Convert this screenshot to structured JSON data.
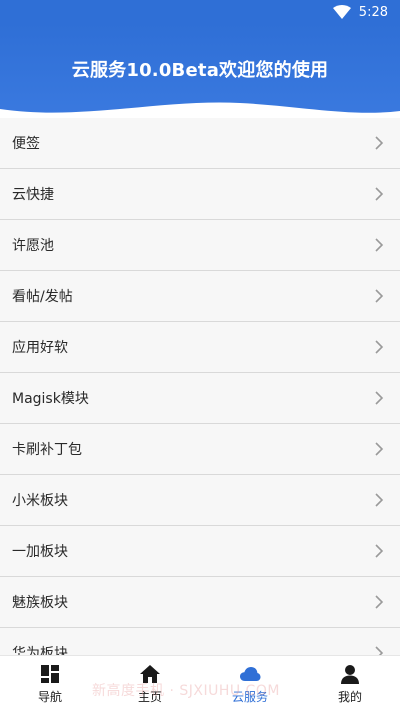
{
  "status_bar": {
    "time": "5:28"
  },
  "header": {
    "title": "云服务10.0Beta欢迎您的使用"
  },
  "list": {
    "items": [
      {
        "label": "便签"
      },
      {
        "label": "云快捷"
      },
      {
        "label": "许愿池"
      },
      {
        "label": "看帖/发帖"
      },
      {
        "label": "应用好软"
      },
      {
        "label": "Magisk模块"
      },
      {
        "label": "卡刷补丁包"
      },
      {
        "label": "小米板块"
      },
      {
        "label": "一加板块"
      },
      {
        "label": "魅族板块"
      },
      {
        "label": "华为板块"
      }
    ]
  },
  "bottom_nav": {
    "items": [
      {
        "label": "导航",
        "icon": "grid-icon",
        "active": false
      },
      {
        "label": "主页",
        "icon": "home-icon",
        "active": false
      },
      {
        "label": "云服务",
        "icon": "cloud-icon",
        "active": true
      },
      {
        "label": "我的",
        "icon": "person-icon",
        "active": false
      }
    ]
  },
  "watermark": "新高度手机 · SJXIUHU.COM",
  "colors": {
    "primary": "#2f6fd6",
    "background": "#f7f7f7",
    "divider": "#d9d9d9"
  }
}
